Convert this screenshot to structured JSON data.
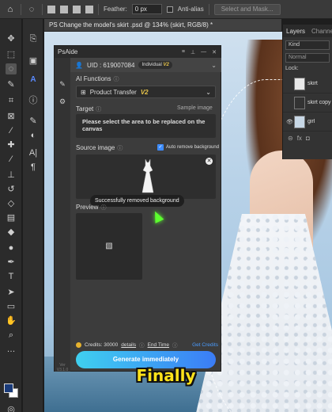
{
  "options_bar": {
    "feather_label": "Feather:",
    "feather_value": "0 px",
    "anti_alias_label": "Anti-alias",
    "select_mask_label": "Select and Mask..."
  },
  "document": {
    "tab_title": "PS Change the model's skirt .psd @ 134% (skirt, RGB/8) *"
  },
  "layers_panel": {
    "tab_layers": "Layers",
    "tab_channels": "Channels",
    "kind_label": "Kind",
    "mode_label": "Normal",
    "lock_label": "Lock:",
    "layers": [
      {
        "name": "skirt"
      },
      {
        "name": "skirt copy"
      },
      {
        "name": "girl"
      }
    ],
    "footer_link": "fx"
  },
  "psaide": {
    "title": "PsAide",
    "uid_label": "UID : 619007084",
    "plan_label": "Individual",
    "plan_version": "V2",
    "ai_functions_label": "AI Functions",
    "function_selected": "Product Transfer",
    "function_version": "V2",
    "target_label": "Target",
    "sample_image_link": "Sample image",
    "target_message": "Please select the area to be replaced on the canvas",
    "source_label": "Source image",
    "auto_remove_label": "Auto remove background",
    "toast": "Successfully removed background",
    "preview_label": "Preview",
    "credits_label": "Credits: 30000",
    "details_link": "details",
    "end_time_link": "End Time",
    "get_credits_link": "Get Credits",
    "generate_button": "Generate immediately",
    "version_line1": "Ver",
    "version_line2": "V3.1.0"
  },
  "caption": "Finally",
  "colors": {
    "foreground": "#1a3b7a",
    "background": "#ffffff",
    "accent": "#3b7cf6",
    "highlight": "#e6c34a"
  }
}
